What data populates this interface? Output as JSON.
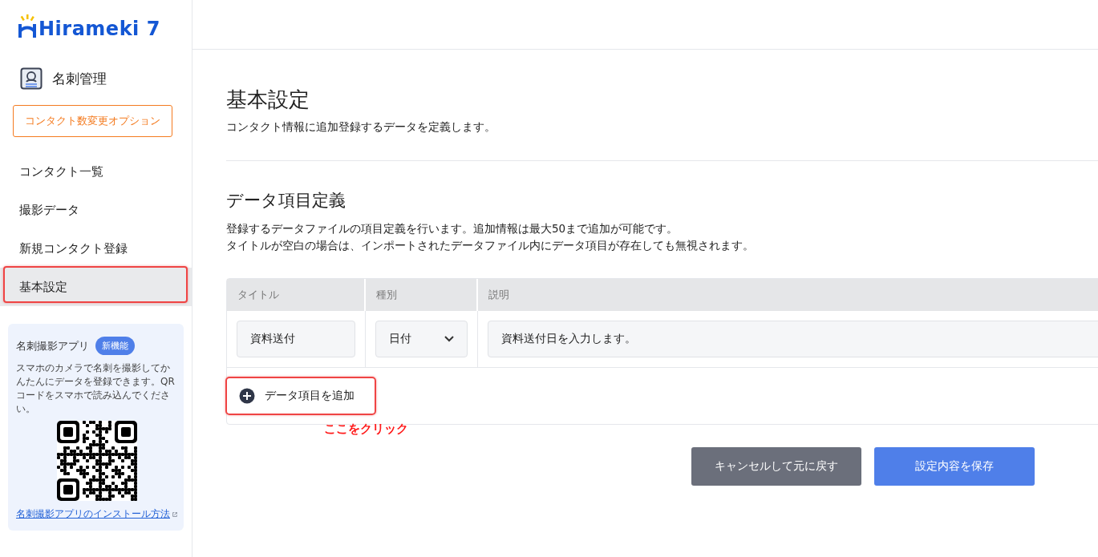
{
  "logo": {
    "text": "Hirameki 7"
  },
  "sidebar": {
    "section": "名刺管理",
    "option_button": "コンタクト数変更オプション",
    "items": [
      {
        "label": "コンタクト一覧",
        "selected": false,
        "highlighted": false
      },
      {
        "label": "撮影データ",
        "selected": false,
        "highlighted": false
      },
      {
        "label": "新規コンタクト登録",
        "selected": false,
        "highlighted": false
      },
      {
        "label": "基本設定",
        "selected": true,
        "highlighted": true
      }
    ],
    "promo": {
      "title": "名刺撮影アプリ",
      "badge": "新機能",
      "text": "スマホのカメラで名刺を撮影してかんたんにデータを登録できます。QRコードをスマホで読み込んでください。",
      "link": "名刺撮影アプリのインストール方法"
    }
  },
  "main": {
    "title": "基本設定",
    "subtitle": "コンタクト情報に追加登録するデータを定義します。",
    "section_title": "データ項目定義",
    "section_desc": [
      "登録するデータファイルの項目定義を行います。追加情報は最大50まで追加が可能です。",
      "タイトルが空白の場合は、インポートされたデータファイル内にデータ項目が存在しても無視されます。"
    ],
    "table": {
      "columns": [
        "タイトル",
        "種別",
        "説明"
      ],
      "rows": [
        {
          "title": "資料送付",
          "type": "日付",
          "description": "資料送付日を入力します。"
        }
      ]
    },
    "add_button": {
      "label": "データ項目を追加",
      "highlighted": true
    },
    "annotation": "ここをクリック",
    "buttons": [
      {
        "label": "キャンセルして元に戻す",
        "kind": "secondary"
      },
      {
        "label": "設定内容を保存",
        "kind": "primary"
      }
    ]
  }
}
